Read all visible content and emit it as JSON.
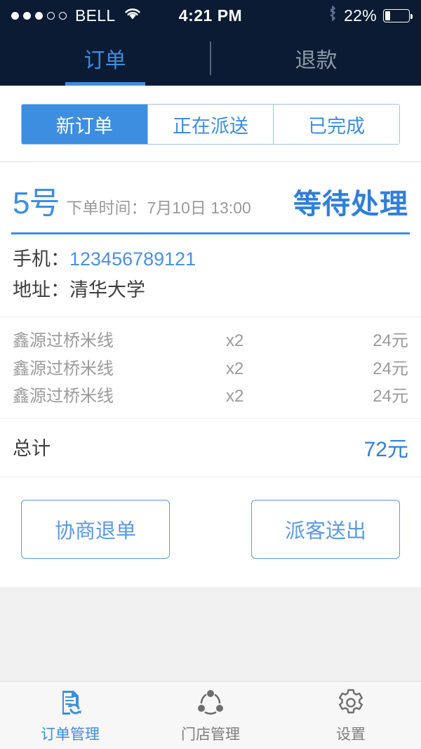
{
  "status_bar": {
    "carrier": "BELL",
    "signal_filled": 3,
    "signal_total": 5,
    "wifi_icon": "wifi-icon",
    "time": "4:21 PM",
    "bluetooth_icon": "bluetooth-icon",
    "battery_percent": "22%",
    "battery_level": 22
  },
  "navbar": {
    "tabs": [
      {
        "label": "订单",
        "active": true
      },
      {
        "label": "退款",
        "active": false
      }
    ]
  },
  "segmented": {
    "options": [
      {
        "label": "新订单",
        "active": true
      },
      {
        "label": "正在派送",
        "active": false
      },
      {
        "label": "已完成",
        "active": false
      }
    ]
  },
  "order": {
    "number": "5号",
    "time_label": "下单时间：",
    "time_value": "7月10日 13:00",
    "time_text": "下单时间：7月10日 13:00",
    "status": "等待处理",
    "phone_label": "手机：",
    "phone_value": "123456789121",
    "address_label": "地址：",
    "address_value": "清华大学",
    "items": [
      {
        "name": "鑫源过桥米线",
        "qty": "x2",
        "price": "24元"
      },
      {
        "name": "鑫源过桥米线",
        "qty": "x2",
        "price": "24元"
      },
      {
        "name": "鑫源过桥米线",
        "qty": "x2",
        "price": "24元"
      }
    ],
    "total_label": "总计",
    "total_value": "72元",
    "actions": [
      {
        "label": "协商退单"
      },
      {
        "label": "派客送出"
      }
    ]
  },
  "tabbar": {
    "tabs": [
      {
        "label": "订单管理",
        "icon": "order-document-refresh-icon",
        "active": true
      },
      {
        "label": "门店管理",
        "icon": "store-network-icon",
        "active": false
      },
      {
        "label": "设置",
        "icon": "gear-icon",
        "active": false
      }
    ]
  },
  "colors": {
    "navy": "#0a1b33",
    "accent_blue": "#3d8ee0",
    "link_blue": "#4a90e2",
    "muted_gray": "#9b9b9b",
    "page_bg": "#f0f0f0"
  }
}
